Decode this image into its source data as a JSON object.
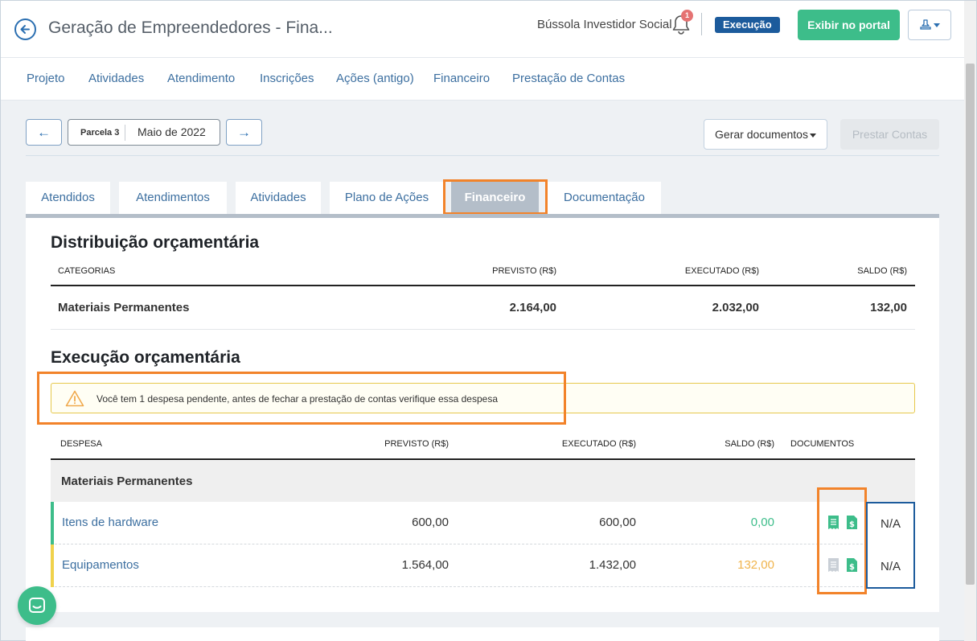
{
  "header": {
    "title": "Geração de Empreendedores - Fina...",
    "org_name": "Bússola Investidor Social",
    "notification_count": "1",
    "status_badge": "Execução",
    "portal_button": "Exibir no portal"
  },
  "nav": [
    "Projeto",
    "Atividades",
    "Atendimento",
    "Inscrições",
    "Ações (antigo)",
    "Financeiro",
    "Prestação de Contas"
  ],
  "toolbar": {
    "prev_arrow": "←",
    "next_arrow": "→",
    "parcela_label": "Parcela 3",
    "parcela_month": "Maio de 2022",
    "gerar_documentos": "Gerar documentos",
    "prestar_contas": "Prestar Contas"
  },
  "tabs": [
    "Atendidos",
    "Atendimentos",
    "Atividades",
    "Plano de Ações",
    "Financeiro",
    "Documentação"
  ],
  "active_tab": "Financeiro",
  "distribution": {
    "title": "Distribuição orçamentária",
    "headers": [
      "CATEGORIAS",
      "PREVISTO (R$)",
      "EXECUTADO (R$)",
      "SALDO (R$)"
    ],
    "rows": [
      {
        "categoria": "Materiais Permanentes",
        "previsto": "2.164,00",
        "executado": "2.032,00",
        "saldo": "132,00"
      }
    ]
  },
  "execution": {
    "title": "Execução orçamentária",
    "alert": "Você tem 1 despesa pendente, antes de fechar a prestação de contas verifique essa despesa",
    "headers": [
      "DESPESA",
      "PREVISTO (R$)",
      "EXECUTADO (R$)",
      "SALDO (R$)",
      "DOCUMENTOS"
    ],
    "group": "Materiais Permanentes",
    "rows": [
      {
        "despesa": "Itens de hardware",
        "previsto": "600,00",
        "executado": "600,00",
        "saldo": "0,00",
        "na": "N/A"
      },
      {
        "despesa": "Equipamentos",
        "previsto": "1.564,00",
        "executado": "1.432,00",
        "saldo": "132,00",
        "na": "N/A"
      }
    ]
  },
  "colors": {
    "accent": "#2b6fb1",
    "green": "#3dbd8a",
    "warning": "#f0b44c",
    "highlight": "#f2832a"
  }
}
